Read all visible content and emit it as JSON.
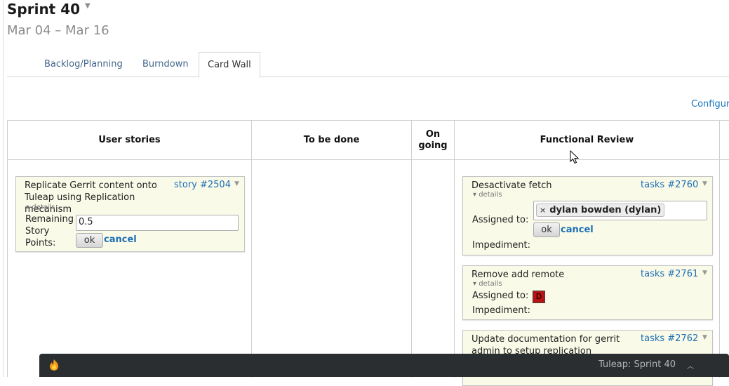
{
  "header": {
    "title": "Sprint 40",
    "title_caret_icon": "caret-down-icon",
    "dates": "Mar 04 – Mar 16"
  },
  "tabs": [
    {
      "label": "Backlog/Planning",
      "active": false
    },
    {
      "label": "Burndown",
      "active": false
    },
    {
      "label": "Card Wall",
      "active": true
    }
  ],
  "configure_link": "Configur",
  "columns": [
    {
      "label": "User stories"
    },
    {
      "label": "To be done"
    },
    {
      "label": "On going"
    },
    {
      "label": "Functional Review"
    }
  ],
  "story_card": {
    "title": "Replicate Gerrit content onto Tuleap using Replication mecanism",
    "id": "story #2504",
    "details_label": "details",
    "field_label": "Remaining Story Points:",
    "field_value": "0.5",
    "ok_label": "ok",
    "cancel_label": "cancel"
  },
  "task_cards": [
    {
      "title": "Desactivate fetch",
      "id": "tasks #2760",
      "details_label": "details",
      "assigned_label": "Assigned to:",
      "assignee_chip": "dylan bowden (dylan)",
      "chip_remove_icon": "×",
      "ok_label": "ok",
      "cancel_label": "cancel",
      "impediment_label": "Impediment:"
    },
    {
      "title": "Remove add remote",
      "id": "tasks #2761",
      "details_label": "details",
      "assigned_label": "Assigned to:",
      "avatar_letter": "D",
      "impediment_label": "Impediment:"
    },
    {
      "title": "Update documentation for gerrit admin to setup replication",
      "id": "tasks #2762"
    }
  ],
  "taskbar": {
    "app_icon": "firefox-icon",
    "window_title": "Tuleap: Sprint 40",
    "expand_icon": "chevron-up-icon"
  },
  "colors": {
    "link": "#1c6fb5",
    "card_bg": "#fafae8",
    "taskbar_bg": "#2b2e31",
    "avatar_bg": "#b81414"
  }
}
